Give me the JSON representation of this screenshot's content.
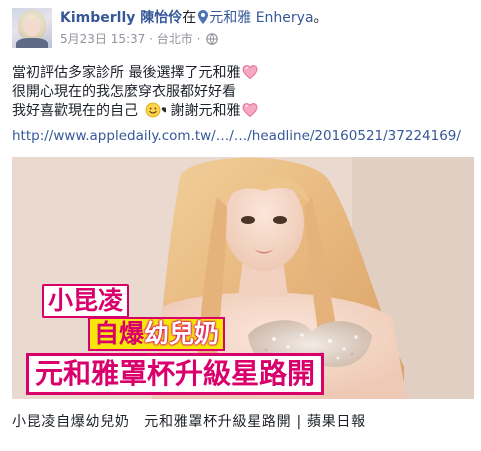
{
  "post": {
    "author_name": "Kimberlly 陳怡伶",
    "at_word": "在",
    "place": "元和雅 Enherya",
    "after_place": "。",
    "date": "5月23日 15:37",
    "separator": "·",
    "location": "台北市",
    "location_separator": "·",
    "icons": {
      "place": "location-pin-icon",
      "privacy": "globe-icon"
    },
    "body_lines": [
      {
        "text": "當初評估多家診所 最後選擇了元和雅",
        "emoji": "pink-heart-icon"
      },
      {
        "text": "很開心現在的我怎麼穿衣服都好好看",
        "emoji": ""
      },
      {
        "text": "我好喜歡現在的自己",
        "emoji": "smile-kiss-icon",
        "text2": " 謝謝元和雅",
        "emoji2": "pink-heart-icon"
      }
    ],
    "link": "http://www.appledaily.com.tw/…/…/headline/20160521/37224169/",
    "share": {
      "overlay_line1": "小昆凌",
      "overlay_line2_a": "自爆",
      "overlay_line2_b": "幼兒奶",
      "overlay_line3": "元和雅罩杯升級星路開",
      "caption": "小昆凌自爆幼兒奶　元和雅罩杯升級星路開 | 蘋果日報"
    },
    "colors": {
      "link": "#365899",
      "text": "#1d2129",
      "meta": "#90949c",
      "overlay_magenta": "#d9006c",
      "overlay_yellow": "#f7e60c"
    }
  }
}
